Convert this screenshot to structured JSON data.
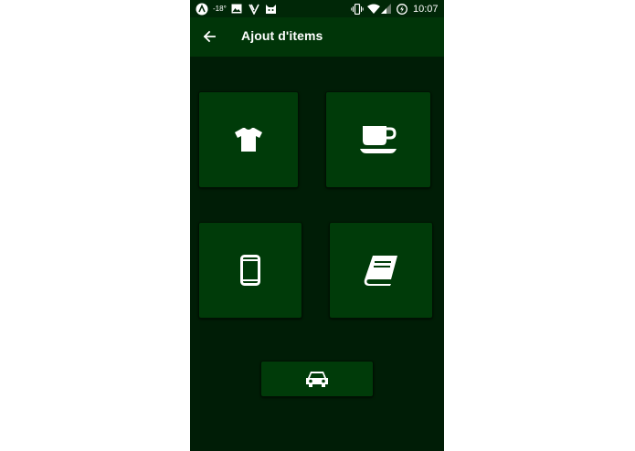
{
  "status_bar": {
    "temperature": "-18°",
    "time": "10:07"
  },
  "app_bar": {
    "title": "Ajout d'items",
    "back_icon": "arrow-left-icon"
  },
  "categories": [
    {
      "icon": "tshirt-icon"
    },
    {
      "icon": "coffee-cup-icon"
    },
    {
      "icon": "smartphone-icon"
    },
    {
      "icon": "book-icon"
    },
    {
      "icon": "car-icon"
    }
  ],
  "colors": {
    "background": "#001d06",
    "status_bar": "#002707",
    "app_bar": "#003508",
    "tile": "#003b09",
    "icon": "#ffffff"
  }
}
